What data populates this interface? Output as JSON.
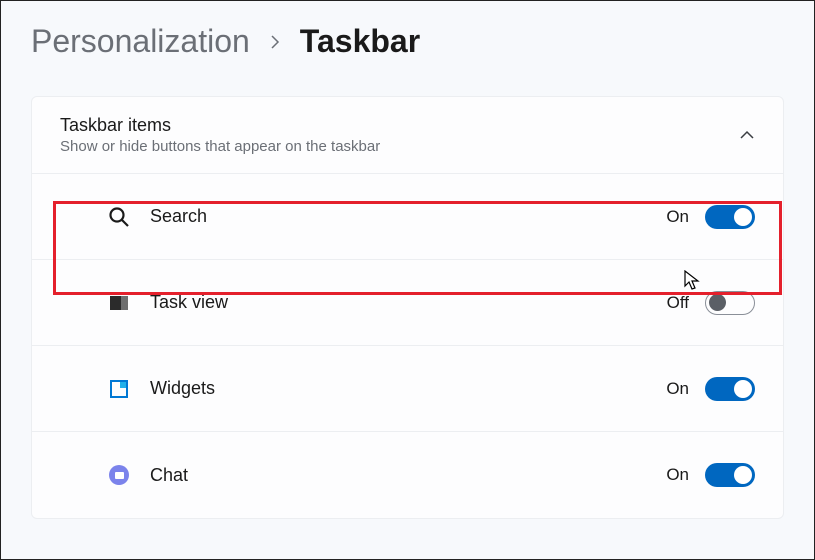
{
  "breadcrumb": {
    "parent": "Personalization",
    "current": "Taskbar"
  },
  "section": {
    "title": "Taskbar items",
    "subtitle": "Show or hide buttons that appear on the taskbar",
    "expanded": true
  },
  "items": [
    {
      "icon": "search-icon",
      "label": "Search",
      "state": "On",
      "on": true
    },
    {
      "icon": "taskview-icon",
      "label": "Task view",
      "state": "Off",
      "on": false
    },
    {
      "icon": "widgets-icon",
      "label": "Widgets",
      "state": "On",
      "on": true
    },
    {
      "icon": "chat-icon",
      "label": "Chat",
      "state": "On",
      "on": true
    }
  ],
  "colors": {
    "accent": "#0067c0",
    "highlight": "#e4202c"
  }
}
